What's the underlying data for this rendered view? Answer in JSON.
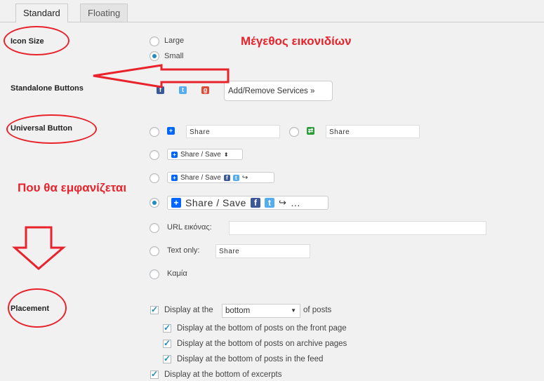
{
  "tabs": [
    {
      "label": "Standard"
    },
    {
      "label": "Floating"
    }
  ],
  "rows": {
    "icon_size": "Icon Size",
    "standalone": "Standalone Buttons",
    "universal": "Universal Button",
    "placement": "Placement"
  },
  "annotations": {
    "icon_size_note": "Μέγεθος εικονιδίων",
    "where_note": "Που θα εμφανίζεται"
  },
  "icon_size": {
    "large": "Large",
    "small": "Small",
    "selected": "Small"
  },
  "standalone": {
    "services": [
      "facebook-icon",
      "twitter-icon",
      "google-plus-icon"
    ],
    "add_remove": "Add/Remove Services »"
  },
  "universal": {
    "share_input_1": "Share",
    "share_input_2": "Share",
    "share_save": "Share / Save",
    "share_save_arrows": "⬍",
    "ellipsis": "…",
    "image_url_label": "URL εικόνας:",
    "text_only_label": "Text only:",
    "text_only_value": "Share",
    "none_label": "Καμία",
    "selected": "large-share-save"
  },
  "placement": {
    "display_at_the": "Display at the",
    "select_value": "bottom",
    "of_posts": "of posts",
    "front": "Display at the bottom of posts on the front page",
    "archive": "Display at the bottom of posts on archive pages",
    "feed": "Display at the bottom of posts in the feed",
    "excerpts": "Display at the bottom of excerpts"
  },
  "colors": {
    "annotation": "#e8232b",
    "accent": "#1e8cbe",
    "addtoany_blue": "#0166ff",
    "facebook": "#3b5998",
    "twitter": "#55acee",
    "google": "#dd4b39"
  }
}
